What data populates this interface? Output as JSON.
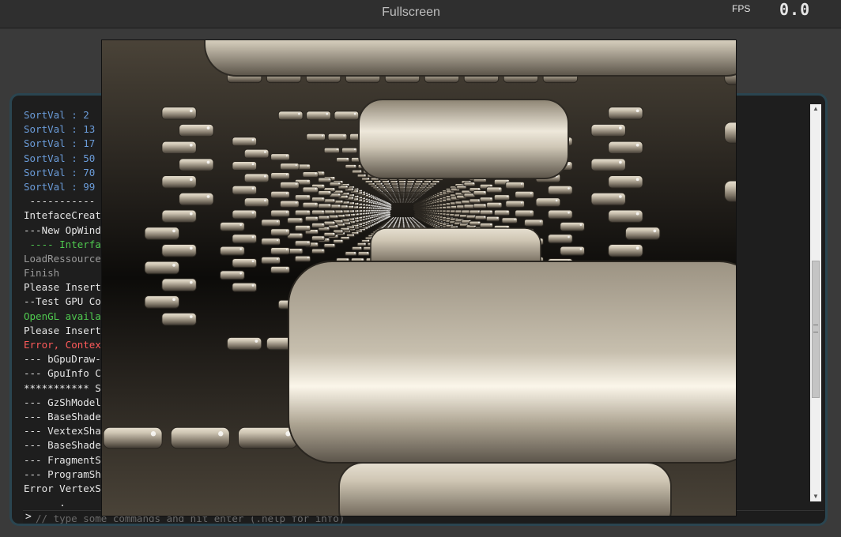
{
  "header": {
    "title": "Fullscreen",
    "fps_label": "FPS",
    "fps_value": "0.0"
  },
  "console": {
    "lines": [
      {
        "text": "SortVal : 2",
        "color": "#6a9bd8"
      },
      {
        "text": "SortVal : 13",
        "color": "#6a9bd8"
      },
      {
        "text": "SortVal : 17",
        "color": "#6a9bd8"
      },
      {
        "text": "SortVal : 50",
        "color": "#6a9bd8"
      },
      {
        "text": "SortVal : 70",
        "color": "#6a9bd8"
      },
      {
        "text": "SortVal : 99",
        "color": "#6a9bd8"
      },
      {
        "text": " -----------",
        "color": "#e6e6e6"
      },
      {
        "text": "IntefaceCreat",
        "color": "#e6e6e6"
      },
      {
        "text": "---New OpWind",
        "color": "#e6e6e6"
      },
      {
        "text": " ---- Interfa",
        "color": "#4fc94f"
      },
      {
        "text": "LoadRessource",
        "color": "#9a9a9a"
      },
      {
        "text": "Finish",
        "color": "#9a9a9a"
      },
      {
        "text": "Please Insert",
        "color": "#e6e6e6"
      },
      {
        "text": "--Test GPU Co",
        "color": "#e6e6e6"
      },
      {
        "text": "OpenGL availa",
        "color": "#4fc94f"
      },
      {
        "text": "Please Insert",
        "color": "#e6e6e6"
      },
      {
        "text": "Error, Contex",
        "color": "#ff5a5a"
      },
      {
        "text": "--- bGpuDraw-",
        "color": "#e6e6e6"
      },
      {
        "text": "--- GpuInfo C",
        "color": "#e6e6e6"
      },
      {
        "text": "*********** S",
        "color": "#e6e6e6"
      },
      {
        "text": "--- GzShModel",
        "color": "#e6e6e6"
      },
      {
        "text": "--- BaseShade",
        "color": "#e6e6e6"
      },
      {
        "text": "--- VextexSha",
        "color": "#e6e6e6"
      },
      {
        "text": "--- BaseShade",
        "color": "#e6e6e6"
      },
      {
        "text": "--- FragmentS",
        "color": "#e6e6e6"
      },
      {
        "text": "--- ProgramSh",
        "color": "#e6e6e6"
      },
      {
        "text": "Error VertexS",
        "color": "#e6e6e6"
      },
      {
        "text": "      .",
        "color": "#e6e6e6"
      }
    ],
    "prompt_symbol": ">",
    "input_placeholder": "// type some commands and hit enter (.help for info)"
  },
  "scrollbar": {
    "up_icon": "arrow-up-icon",
    "down_icon": "arrow-down-icon",
    "position_fraction": 0.56
  },
  "render_view": {
    "description_icon": "3d-render-canvas",
    "brick_color": "#c8bfae"
  }
}
